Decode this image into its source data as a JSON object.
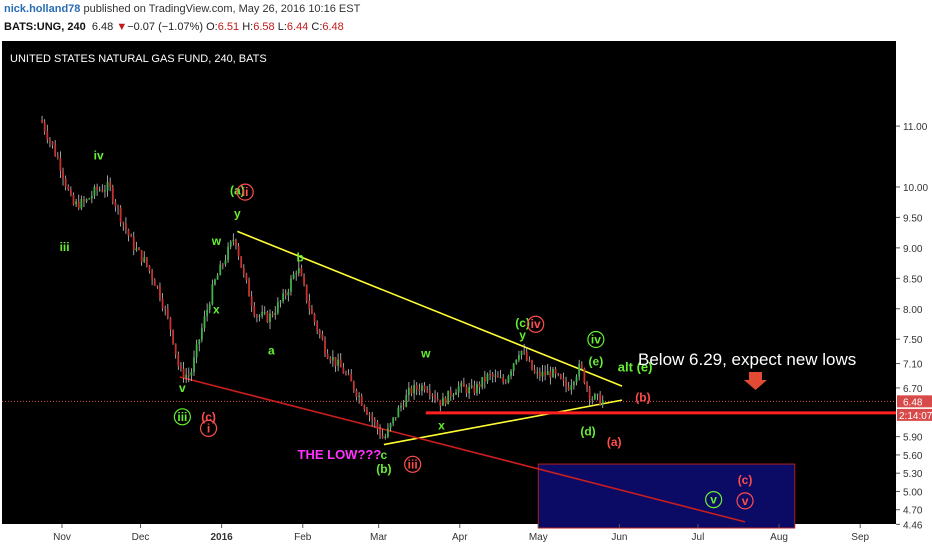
{
  "header": {
    "username": "nick.holland78",
    "published_text": "published on TradingView.com, May 26, 2016 10:16 EST",
    "symbol": "BATS:UNG, 240",
    "last": "6.48",
    "change_arrow": "▼",
    "change": "−0.07 (−1.07%)",
    "open_label": "O:",
    "open": "6.51",
    "high_label": "H:",
    "high": "6.58",
    "low_label": "L:",
    "low": "6.44",
    "close_label": "C:",
    "close": "6.48"
  },
  "chart_data": {
    "type": "candlestick",
    "title": "UNITED STATES NATURAL GAS FUND, 240, BATS",
    "x_labels": [
      "Nov",
      "Dec",
      "2016",
      "Feb",
      "Mar",
      "Apr",
      "May",
      "Jun",
      "Jul",
      "Aug",
      "Sep"
    ],
    "y_ticks": [
      "11.00",
      "10.00",
      "9.50",
      "9.00",
      "8.50",
      "8.00",
      "7.50",
      "7.10",
      "6.70",
      "6.48",
      "2:14:07",
      "5.90",
      "5.60",
      "5.30",
      "5.00",
      "4.70",
      "4.46"
    ],
    "last_price": "6.48",
    "countdown": "2:14:07",
    "support_level": 6.29,
    "price_path": [
      [
        "2015-10-24",
        11.1
      ],
      [
        "2015-10-31",
        10.4
      ],
      [
        "2015-11-05",
        9.7
      ],
      [
        "2015-11-10",
        9.75
      ],
      [
        "2015-11-14",
        9.95
      ],
      [
        "2015-11-19",
        10.0
      ],
      [
        "2015-11-23",
        9.55
      ],
      [
        "2015-11-28",
        9.05
      ],
      [
        "2015-12-03",
        8.75
      ],
      [
        "2015-12-08",
        8.3
      ],
      [
        "2015-12-13",
        7.6
      ],
      [
        "2015-12-16",
        6.95
      ],
      [
        "2015-12-20",
        6.9
      ],
      [
        "2015-12-24",
        7.6
      ],
      [
        "2015-12-29",
        8.4
      ],
      [
        "2016-01-02",
        8.8
      ],
      [
        "2016-01-06",
        9.2
      ],
      [
        "2016-01-09",
        8.6
      ],
      [
        "2016-01-14",
        7.9
      ],
      [
        "2016-01-19",
        7.85
      ],
      [
        "2016-01-25",
        8.2
      ],
      [
        "2016-01-30",
        8.7
      ],
      [
        "2016-02-04",
        7.95
      ],
      [
        "2016-02-10",
        7.3
      ],
      [
        "2016-02-17",
        6.95
      ],
      [
        "2016-02-22",
        6.6
      ],
      [
        "2016-02-28",
        6.15
      ],
      [
        "2016-03-03",
        5.85
      ],
      [
        "2016-03-08",
        6.3
      ],
      [
        "2016-03-13",
        6.65
      ],
      [
        "2016-03-19",
        6.75
      ],
      [
        "2016-03-25",
        6.45
      ],
      [
        "2016-03-31",
        6.72
      ],
      [
        "2016-04-06",
        6.65
      ],
      [
        "2016-04-12",
        6.9
      ],
      [
        "2016-04-18",
        6.8
      ],
      [
        "2016-04-24",
        7.35
      ],
      [
        "2016-04-30",
        6.9
      ],
      [
        "2016-05-06",
        6.95
      ],
      [
        "2016-05-12",
        6.7
      ],
      [
        "2016-05-17",
        7.05
      ],
      [
        "2016-05-21",
        6.55
      ],
      [
        "2016-05-26",
        6.48
      ]
    ],
    "trendlines": [
      {
        "name": "triangle-upper",
        "color": "#ffff33",
        "from": [
          "2016-01-07",
          9.27
        ],
        "to": [
          "2016-06-02",
          6.73
        ]
      },
      {
        "name": "triangle-lower",
        "color": "#ffff33",
        "from": [
          "2016-03-03",
          5.77
        ],
        "to": [
          "2016-06-02",
          6.5
        ]
      },
      {
        "name": "channel-lower",
        "color": "#c81e1e",
        "from": [
          "2015-12-16",
          6.88
        ],
        "to": [
          "2016-07-19",
          4.5
        ]
      },
      {
        "name": "x-support",
        "color": "#ff2020",
        "from": [
          "2016-03-19",
          6.29
        ],
        "to": [
          "2016-09-30",
          6.29
        ]
      }
    ],
    "target_box": {
      "from": [
        "2016-05-01",
        5.45
      ],
      "to": [
        "2016-08-07",
        4.4
      ],
      "color": "#0b0b66"
    },
    "annotations": [
      {
        "text": "iii",
        "x": "2015-11-02",
        "y": 8.95,
        "color": "#66ee33",
        "style": "plain"
      },
      {
        "text": "iv",
        "x": "2015-11-15",
        "y": 10.45,
        "color": "#66ee33",
        "style": "plain"
      },
      {
        "text": "v",
        "x": "2015-12-17",
        "y": 6.63,
        "color": "#66ee33",
        "style": "plain"
      },
      {
        "text": "iii",
        "x": "2015-12-17",
        "y": 6.16,
        "color": "#66ee33",
        "style": "circle"
      },
      {
        "text": "(c)",
        "x": "2015-12-27",
        "y": 6.16,
        "color": "#ff4d4d",
        "style": "plain"
      },
      {
        "text": "i",
        "x": "2015-12-27",
        "y": 5.97,
        "color": "#ff4d4d",
        "style": "circle"
      },
      {
        "text": "(a)",
        "x": "2016-01-07",
        "y": 9.88,
        "color": "#66ee33",
        "style": "plain"
      },
      {
        "text": "ii",
        "x": "2016-01-10",
        "y": 9.85,
        "color": "#ff4d4d",
        "style": "circle"
      },
      {
        "text": "y",
        "x": "2016-01-07",
        "y": 9.5,
        "color": "#66ee33",
        "style": "plain"
      },
      {
        "text": "w",
        "x": "2015-12-30",
        "y": 9.05,
        "color": "#66ee33",
        "style": "plain"
      },
      {
        "text": "x",
        "x": "2015-12-30",
        "y": 7.92,
        "color": "#66ee33",
        "style": "plain"
      },
      {
        "text": "b",
        "x": "2016-01-31",
        "y": 8.78,
        "color": "#66ee33",
        "style": "plain"
      },
      {
        "text": "a",
        "x": "2016-01-20",
        "y": 7.25,
        "color": "#66ee33",
        "style": "plain"
      },
      {
        "text": "c",
        "x": "2016-03-03",
        "y": 5.53,
        "color": "#66ee33",
        "style": "plain"
      },
      {
        "text": "(b)",
        "x": "2016-03-03",
        "y": 5.3,
        "color": "#66ee33",
        "style": "plain"
      },
      {
        "text": "iii",
        "x": "2016-03-14",
        "y": 5.38,
        "color": "#ff4d4d",
        "style": "circle"
      },
      {
        "text": "THE LOW???",
        "x": "2016-02-15",
        "y": 5.53,
        "color": "#ff33ff",
        "style": "bold"
      },
      {
        "text": "w",
        "x": "2016-03-19",
        "y": 7.2,
        "color": "#66ee33",
        "style": "plain"
      },
      {
        "text": "x",
        "x": "2016-03-25",
        "y": 6.02,
        "color": "#66ee33",
        "style": "plain"
      },
      {
        "text": "(c)",
        "x": "2016-04-25",
        "y": 7.7,
        "color": "#66ee33",
        "style": "plain"
      },
      {
        "text": "iv",
        "x": "2016-04-30",
        "y": 7.68,
        "color": "#ff4d4d",
        "style": "circle"
      },
      {
        "text": "y",
        "x": "2016-04-25",
        "y": 7.5,
        "color": "#66ee33",
        "style": "plain"
      },
      {
        "text": "iv",
        "x": "2016-05-23",
        "y": 7.43,
        "color": "#66ee33",
        "style": "circle"
      },
      {
        "text": "(e)",
        "x": "2016-05-23",
        "y": 7.07,
        "color": "#66ee33",
        "style": "plain"
      },
      {
        "text": "alt (e)",
        "x": "2016-06-07",
        "y": 6.97,
        "color": "#66ee33",
        "style": "bold"
      },
      {
        "text": "(b)",
        "x": "2016-06-10",
        "y": 6.48,
        "color": "#ff4d4d",
        "style": "plain"
      },
      {
        "text": "(d)",
        "x": "2016-05-20",
        "y": 5.92,
        "color": "#66ee33",
        "style": "plain"
      },
      {
        "text": "(a)",
        "x": "2016-05-30",
        "y": 5.75,
        "color": "#ff4d4d",
        "style": "plain"
      },
      {
        "text": "(c)",
        "x": "2016-07-19",
        "y": 5.12,
        "color": "#ff4d4d",
        "style": "plain"
      },
      {
        "text": "v",
        "x": "2016-07-07",
        "y": 4.8,
        "color": "#66ee33",
        "style": "circle"
      },
      {
        "text": "v",
        "x": "2016-07-19",
        "y": 4.78,
        "color": "#ff4d4d",
        "style": "circle"
      }
    ],
    "callout": {
      "text": "Below 6.29, expect new lows",
      "color": "#ffffff",
      "arrow_color": "#e24a33"
    }
  }
}
